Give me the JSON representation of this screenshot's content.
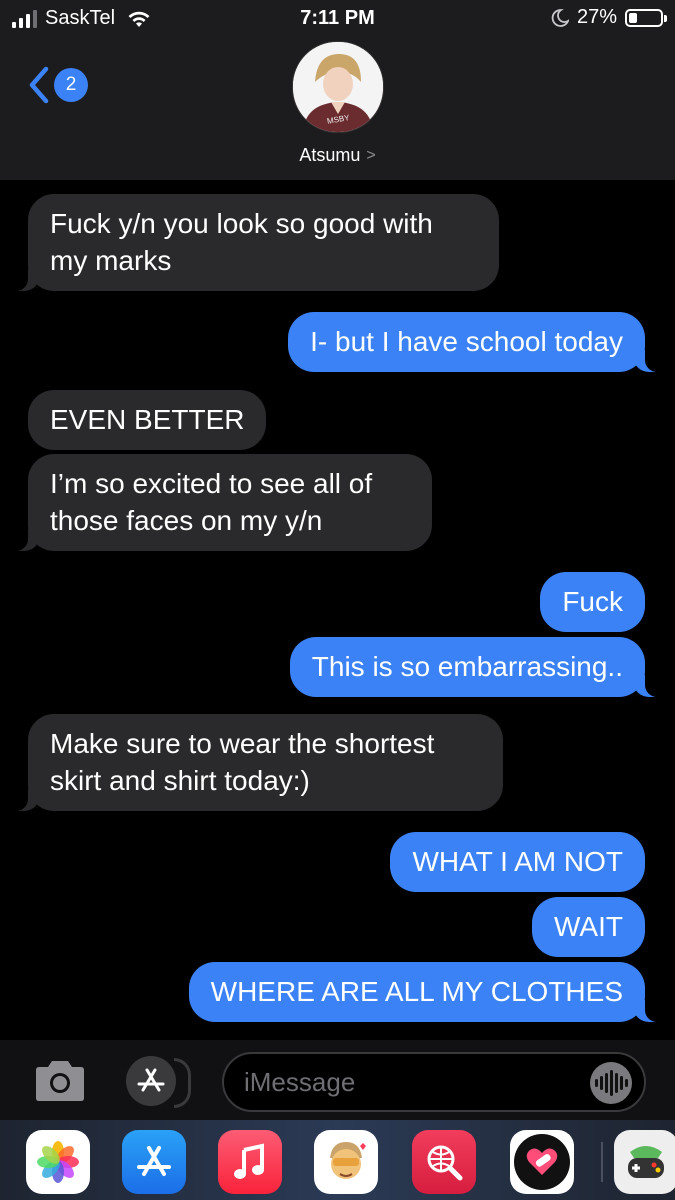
{
  "status_bar": {
    "carrier": "SaskTel",
    "time": "7:11 PM",
    "battery": "27%",
    "battery_level": 0.27
  },
  "header": {
    "back_count": "2",
    "contact_name": "Atsumu",
    "contact_chevron": ">"
  },
  "messages": [
    {
      "direction": "incoming",
      "text": "Fuck y/n you look so good with\nmy marks"
    },
    {
      "direction": "outgoing",
      "text": "I- but I have school today"
    },
    {
      "direction": "incoming",
      "text": "EVEN BETTER"
    },
    {
      "direction": "incoming",
      "text": "I’m so excited to see all of\nthose faces on my y/n"
    },
    {
      "direction": "outgoing",
      "text": "Fuck"
    },
    {
      "direction": "outgoing",
      "text": "This is so embarrassing.."
    },
    {
      "direction": "incoming",
      "text": "Make sure to wear the shortest\nskirt and shirt today:)"
    },
    {
      "direction": "outgoing",
      "text": "WHAT I AM NOT"
    },
    {
      "direction": "outgoing",
      "text": "WAIT"
    },
    {
      "direction": "outgoing",
      "text": "WHERE ARE ALL MY CLOTHES"
    }
  ],
  "input_bar": {
    "placeholder": "iMessage"
  },
  "app_drawer": {
    "apps": [
      "photos-app-icon",
      "app-store-icon",
      "music-app-icon",
      "memoji-sticker-icon",
      "web-search-icon",
      "heart-sticker-icon",
      "game-app-icon"
    ]
  },
  "colors": {
    "outgoing_bubble": "#3b82f6",
    "incoming_bubble": "#2a2a2c",
    "background": "#000000",
    "header": "#1c1c1e"
  }
}
